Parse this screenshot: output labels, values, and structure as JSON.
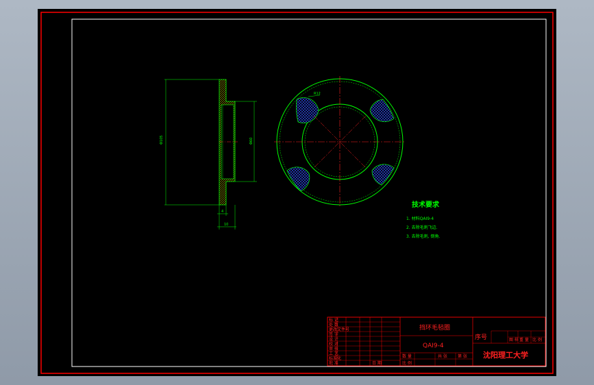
{
  "drawing": {
    "part_name": "挡环毛毡圈",
    "material": "QAI9-4",
    "school": "沈阳理工大学",
    "seq_label": "序号",
    "title_block": {
      "left_labels": [
        "标 记",
        "处 数",
        "更改文件号",
        "签 字",
        "设 计",
        "校 对",
        "审 核",
        "工 艺",
        "标准化",
        "批 准",
        "日 期"
      ],
      "right_small": [
        "图 样",
        "重 量",
        "比 例"
      ],
      "bottom_labels": [
        "数 量",
        "比 例",
        "共 张",
        "第 张"
      ]
    },
    "tech_req": {
      "title": "技术要求",
      "items": [
        "1. 材料QAI9-4",
        "2. 去除毛刺飞边.",
        "3. 去除毛刺, 倒角."
      ]
    },
    "dims": {
      "outer_dia": "Φ105",
      "inner_dia": "Φ60",
      "small_dim": "4",
      "width": "10",
      "radius": "R12"
    },
    "colors": {
      "outline": "#00ff00",
      "centerline": "#ff2020",
      "hatch": "#0000ff",
      "frame": "#ff0000",
      "inner_frame": "#ffffff"
    }
  }
}
